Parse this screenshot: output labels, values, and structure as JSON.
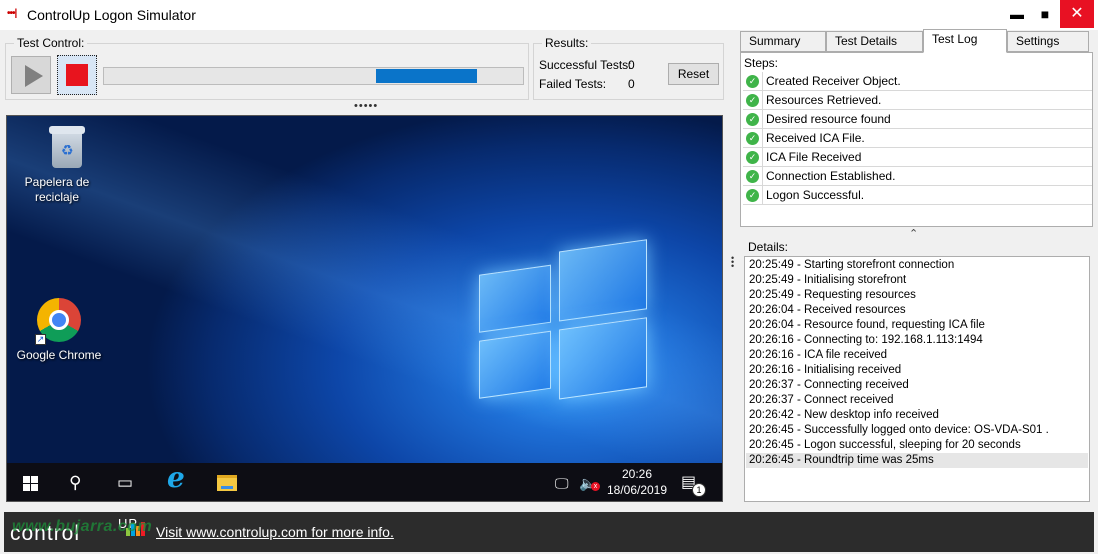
{
  "window": {
    "title": "ControlUp Logon Simulator",
    "icon": "controlup-icon",
    "controls": {
      "minimize": "▬",
      "maximize": "■",
      "close": "✕"
    }
  },
  "test_control": {
    "title": "Test Control:",
    "play_icon": "play-icon",
    "stop_icon": "stop-icon",
    "progress": {
      "fill_percent": 24,
      "offset_percent": 65,
      "color": "#0a74c9"
    }
  },
  "results": {
    "title": "Results:",
    "successful_label": "Successful Tests:",
    "successful_value": "0",
    "failed_label": "Failed Tests:",
    "failed_value": "0",
    "reset_label": "Reset"
  },
  "desktop": {
    "icons": [
      {
        "name": "recycle-bin-icon",
        "label_line1": "Papelera de",
        "label_line2": "reciclaje"
      },
      {
        "name": "google-chrome-icon",
        "label": "Google Chrome"
      }
    ],
    "taskbar": {
      "icons": [
        "windows-start-icon",
        "search-icon",
        "task-view-icon",
        "internet-explorer-icon",
        "file-explorer-icon",
        "network-icon",
        "speaker-muted-icon",
        "notifications-icon"
      ],
      "time": "20:26",
      "date": "18/06/2019",
      "notification_count": "1",
      "ie_glyph": "e",
      "search_glyph": "⚲",
      "taskview_glyph": "▭",
      "network_glyph": "🖵",
      "speaker_glyph": "🔈",
      "mute_glyph": "x",
      "notif_glyph": "▤"
    },
    "colors": {
      "wallpaper": "#0d46a8",
      "taskbar": "#0d0d14"
    }
  },
  "tabs": [
    {
      "label": "Summary",
      "active": false
    },
    {
      "label": "Test Details",
      "active": false
    },
    {
      "label": "Test Log",
      "active": true
    },
    {
      "label": "Settings",
      "active": false
    }
  ],
  "steps": {
    "title": "Steps:",
    "items": [
      "Created Receiver Object.",
      "Resources Retrieved.",
      "Desired resource found",
      "Received ICA File.",
      "ICA File Received",
      "Connection Established.",
      "Logon Successful."
    ],
    "check_color": "#3fb449",
    "check_glyph": "✓"
  },
  "collapse_glyph": "⌃",
  "details": {
    "title": "Details:",
    "lines": [
      "20:25:49 - Starting storefront connection",
      "20:25:49 - Initialising storefront",
      "20:25:49 - Requesting resources",
      "20:26:04 - Received resources",
      "20:26:04 - Resource found, requesting ICA file",
      "20:26:16 - Connecting to: 192.168.1.113:1494",
      "20:26:16 - ICA file received",
      "20:26:16 - Initialising received",
      "20:26:37 - Connecting received",
      "20:26:37 - Connect received",
      "20:26:42 - New desktop info received",
      "20:26:45 - Successfully logged onto device: OS-VDA-S01 .",
      "20:26:45 - Logon successful, sleeping for 20 seconds",
      "20:26:45 - Roundtrip time was 25ms"
    ],
    "selected_index": 13
  },
  "footer": {
    "logo_text": "control",
    "logo_up": "UP",
    "link_text": "Visit www.controlup.com for more info.",
    "watermark": "www.bujarra.com",
    "colors": {
      "bar1": "#8dc63f",
      "bar2": "#00a3e0",
      "bar3": "#f7941d",
      "bar4": "#ed1c24"
    }
  }
}
